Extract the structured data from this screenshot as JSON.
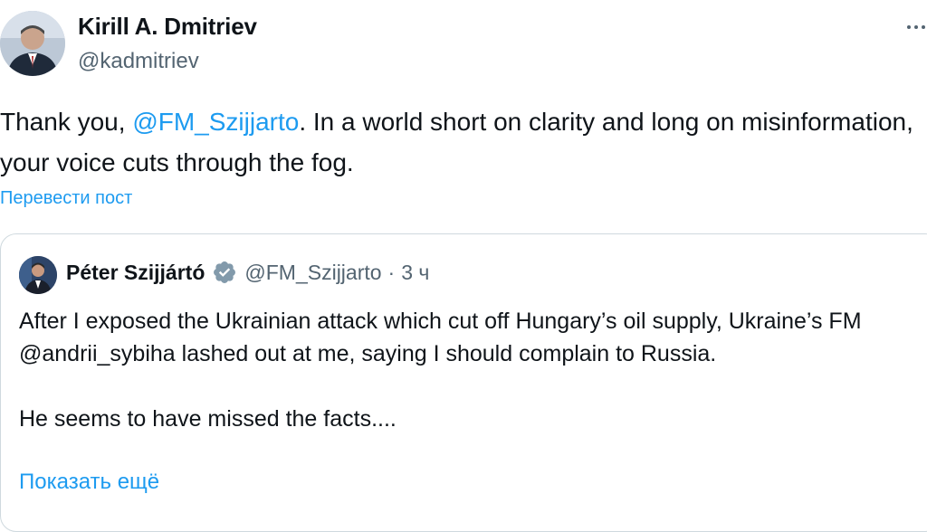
{
  "tweet": {
    "author_name": "Kirill A. Dmitriev",
    "author_handle": "@kadmitriev",
    "avatar_icon": "profile-photo",
    "more_icon": "ellipsis-icon",
    "text_before": "Thank you, ",
    "mention": "@FM_Szijjarto",
    "text_after": ". In a world short on clarity and long on misinformation, your voice cuts through the fog.",
    "translate_label": "Перевести пост"
  },
  "quoted": {
    "author_name": "Péter Szijjártó",
    "verified_icon": "verified-badge-icon",
    "author_handle": "@FM_Szijjarto",
    "separator": "·",
    "time": "3 ч",
    "text": "After I exposed the Ukrainian attack which cut off Hungary’s oil supply, Ukraine’s FM @andrii_sybiha lashed out at me, saying I should complain to Russia.\n\nHe seems to have missed the facts....",
    "show_more_label": "Показать ещё"
  },
  "colors": {
    "link": "#1d9bf0",
    "secondary_text": "#536471",
    "border": "#cfd9de"
  }
}
